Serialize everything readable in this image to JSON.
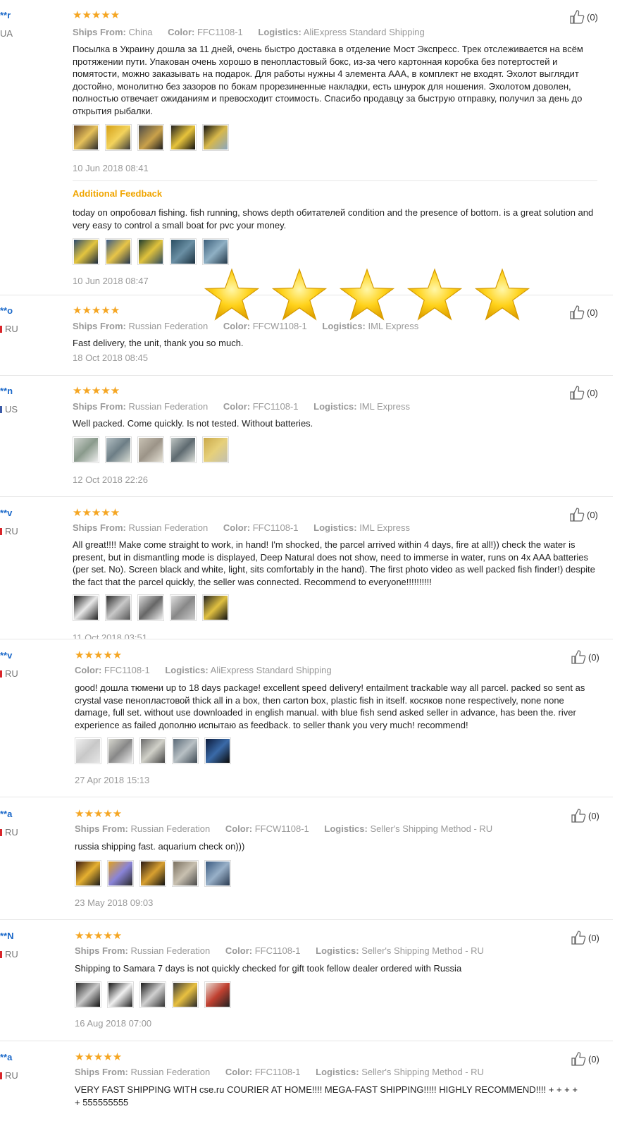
{
  "labels": {
    "ships_from": "Ships From:",
    "color": "Color:",
    "logistics": "Logistics:"
  },
  "helpful_count": "(0)",
  "additional_feedback_label": "Additional Feedback",
  "reviews": [
    {
      "user": "**r",
      "country": "UA",
      "ships_from": "China",
      "color": "FFC1108-1",
      "logistics": "AliExpress Standard Shipping",
      "text": "Посылка в Украину дошла за 11 дней, очень быстро доставка в отделение Мост Экспресс. Трек отслеживается на всём протяжении пути. Упакован очень хорошо в пенопластовый бокс, из-за чего картонная коробка без потертостей и помятости, можно заказывать на подарок. Для работы нужны 4 элемента AAA, в комплект не входят. Эхолот выглядит достойно, монолитно без зазоров по бокам прорезиненные накладки, есть шнурок для ношения. Эхолотом доволен, полностью отвечает ожиданиям и превосходит стоимость. Спасибо продавцу за быструю отправку, получил за день до открытия рыбалки.",
      "date": "10 Jun 2018 08:41",
      "additional_text": "today on опробовал fishing. fish running, shows depth обитателей condition and the presence of bottom. is a great solution and very easy to control a small boat for pvc your money.",
      "additional_date": "10 Jun 2018 08:47"
    },
    {
      "user": "**o",
      "country": "RU",
      "ships_from": "Russian Federation",
      "color": "FFCW1108-1",
      "logistics": "IML Express",
      "text": "Fast delivery, the unit, thank you so much.",
      "date": "18 Oct 2018 08:45"
    },
    {
      "user": "**n",
      "country": "US",
      "ships_from": "Russian Federation",
      "color": "FFC1108-1",
      "logistics": "IML Express",
      "text": "Well packed. Come quickly. Is not tested. Without batteries.",
      "date": "12 Oct 2018 22:26"
    },
    {
      "user": "**v",
      "country": "RU",
      "ships_from": "Russian Federation",
      "color": "FFC1108-1",
      "logistics": "IML Express",
      "text": "All great!!!! Make come straight to work, in hand! I'm shocked, the parcel arrived within 4 days, fire at all!)) check the water is present, but in dismantling mode is displayed, Deep Natural does not show, need to immerse in water, runs on 4x AAA batteries (per set. No). Screen black and white, light, sits comfortably in the hand). The first photo video as well packed fish finder!) despite the fact that the parcel quickly, the seller was connected. Recommend to everyone!!!!!!!!!!",
      "date": "11 Oct 2018 03:51"
    },
    {
      "user": "**v",
      "country": "RU",
      "color": "FFC1108-1",
      "logistics": "AliExpress Standard Shipping",
      "text": "good! дошла тюмени up to 18 days package! excellent speed delivery! entailment trackable way all parcel. packed so sent as crystal vase пенопластовой thick all in a box, then carton box, plastic fish in itself. косяков none respectively, none none damage, full set. without use downloaded in english manual. with blue fish send asked seller in advance, has been the. river experience as failed дополню испытаю as feedback. to seller thank you very much! recommend!",
      "date": "27 Apr 2018 15:13"
    },
    {
      "user": "**a",
      "country": "RU",
      "ships_from": "Russian Federation",
      "color": "FFCW1108-1",
      "logistics": "Seller's Shipping Method - RU",
      "text": "russia shipping fast. aquarium check on)))",
      "date": "23 May 2018 09:03"
    },
    {
      "user": "**N",
      "country": "RU",
      "ships_from": "Russian Federation",
      "color": "FFC1108-1",
      "logistics": "Seller's Shipping Method - RU",
      "text": "Shipping to Samara 7 days is not quickly checked for gift took fellow dealer ordered with Russia",
      "date": "16 Aug 2018 07:00"
    },
    {
      "user": "**a",
      "country": "RU",
      "ships_from": "Russian Federation",
      "color": "FFC1108-1",
      "logistics": "Seller's Shipping Method - RU",
      "text": "VERY FAST SHIPPING WITH cse.ru COURIER AT HOME!!!! MEGA-FAST SHIPPING!!!!! HIGHLY RECOMMEND!!!! + + + + + 555555555"
    }
  ],
  "ratings": [
    5,
    5,
    5,
    5,
    5,
    5,
    5,
    5
  ],
  "overlay_rating": 5
}
